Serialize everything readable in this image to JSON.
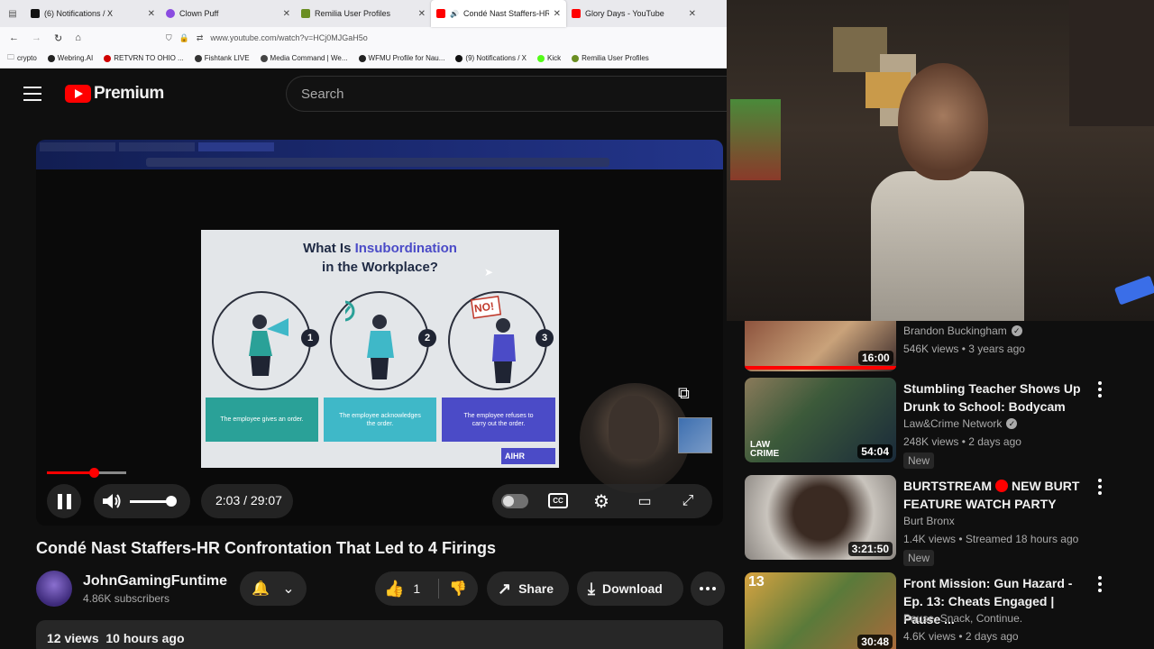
{
  "browser": {
    "tabs": [
      {
        "label": "(6) Notifications / X",
        "active": false,
        "fav": "#111111"
      },
      {
        "label": "Clown Puff",
        "active": false,
        "fav": "#8a4be0"
      },
      {
        "label": "Remilia User Profiles",
        "active": false,
        "fav": "#6b8e23"
      },
      {
        "label": "Condé Nast Staffers-HR Co",
        "active": true,
        "fav": "#ff0000"
      },
      {
        "label": "Glory Days - YouTube",
        "active": false,
        "fav": "#ff0000"
      }
    ],
    "url": "www.youtube.com/watch?v=HCj0MJGaH5o",
    "bookmarks": [
      {
        "label": "crypto",
        "color": "#888888"
      },
      {
        "label": "Webring.AI",
        "color": "#222222"
      },
      {
        "label": "RETVRN TO OHIO ...",
        "color": "#d00000"
      },
      {
        "label": "Fishtank LIVE",
        "color": "#333333"
      },
      {
        "label": "Media Command | We...",
        "color": "#444444"
      },
      {
        "label": "WFMU Profile for Nau...",
        "color": "#222222"
      },
      {
        "label": "(9) Notifications / X",
        "color": "#111111"
      },
      {
        "label": "Kick",
        "color": "#53fc18"
      },
      {
        "label": "Remilia User Profiles",
        "color": "#6b8e23"
      }
    ]
  },
  "header": {
    "logo_text": "Premium",
    "search_placeholder": "Search"
  },
  "player": {
    "slide": {
      "title_pre": "What Is ",
      "title_hl": "Insubordination",
      "title_post": "in the Workplace?",
      "steps": [
        {
          "num": "1",
          "text": "The employee gives an order.",
          "color": "#2aa198"
        },
        {
          "num": "2",
          "text": "The employee acknowledges the order.",
          "color": "#3fb8c8"
        },
        {
          "num": "3",
          "text": "The employee refuses to carry out the order.",
          "color": "#4b4bc7"
        }
      ],
      "no_sign": "NO!",
      "brand": "AIHR"
    },
    "time_current": "2:03",
    "time_total": "29:07",
    "time_display": "2:03 / 29:07",
    "progress": 0.07,
    "volume": 0.9
  },
  "video": {
    "title": "Condé Nast Staffers-HR Confrontation That Led to 4 Firings",
    "channel": "JohnGamingFuntime",
    "subscribers": "4.86K subscribers",
    "likes": "1",
    "share_label": "Share",
    "download_label": "Download",
    "views_line": "12 views  10 hours ago"
  },
  "recommendations": [
    {
      "title": "",
      "channel": "Brandon Buckingham",
      "verified": true,
      "meta": "546K views • 3 years ago",
      "duration": "16:00",
      "badge": "",
      "thumb": "#5a2a2a"
    },
    {
      "title": "Stumbling Teacher Shows Up Drunk to School: Bodycam",
      "channel": "Law&Crime Network",
      "verified": true,
      "meta": "248K views • 2 days ago",
      "duration": "54:04",
      "badge": "New",
      "thumb": "#3c5a3a"
    },
    {
      "title_pre": "BURTSTREAM",
      "title_post": "NEW BURT FEATURE WATCH PARTY",
      "channel": "Burt Bronx",
      "verified": false,
      "meta": "1.4K views • Streamed 18 hours ago",
      "duration": "3:21:50",
      "badge": "New",
      "thumb": "#c9c4bd"
    },
    {
      "title": "Front Mission: Gun Hazard - Ep. 13: Cheats Engaged | Pause ...",
      "channel": "Pause, Snack, Continue.",
      "verified": false,
      "meta": "4.6K views • 2 days ago",
      "duration": "30:48",
      "badge": "",
      "thumb": "#d9a441"
    }
  ]
}
